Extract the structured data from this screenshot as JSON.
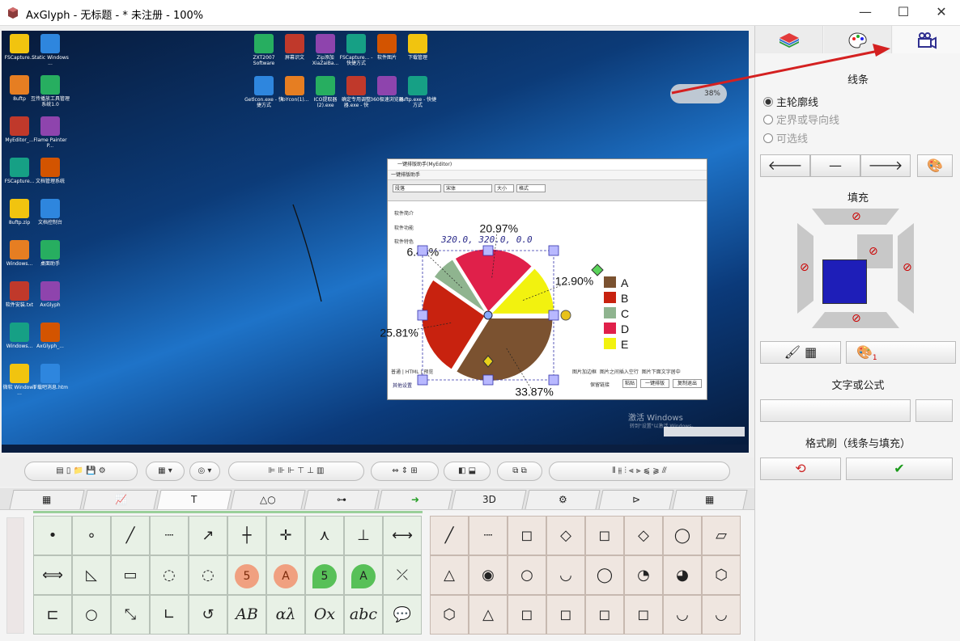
{
  "window": {
    "title": "AxGlyph - 无标题 - * 未注册 - 100%",
    "minimize": "—",
    "maximize": "☐",
    "close": "✕"
  },
  "desktop": {
    "icons": [
      {
        "label": "FSCapture..."
      },
      {
        "label": "Static Windows ..."
      },
      {
        "label": "8uftp"
      },
      {
        "label": "互传播放工具管理系统1.0"
      },
      {
        "label": "MyEditor_..."
      },
      {
        "label": "Flame Painter P..."
      },
      {
        "label": "FSCapture..."
      },
      {
        "label": "文档管理系统"
      },
      {
        "label": "8uftp.zip"
      },
      {
        "label": "文档控制台"
      },
      {
        "label": "Windows..."
      },
      {
        "label": "桌面助手"
      },
      {
        "label": "软件安装.txt"
      },
      {
        "label": "AxGlyph"
      },
      {
        "label": "Windows..."
      },
      {
        "label": "AxGlyph_..."
      },
      {
        "label": "微软 Windows ..."
      },
      {
        "label": "下载吧消息.htm"
      }
    ],
    "top_icons": [
      {
        "label": "ZXT2007 Software"
      },
      {
        "label": "屏幕识文"
      },
      {
        "label": "Zip添加 XiaZaiBa..."
      },
      {
        "label": "FSCapture... - 快捷方式"
      },
      {
        "label": "软件图片"
      },
      {
        "label": "下载管理"
      },
      {
        "label": "Getlcon.exe - 快捷方式"
      },
      {
        "label": "ToYcon(1)..."
      },
      {
        "label": "ICO提取器 (2).exe"
      },
      {
        "label": "确定专用调整器.exe - 快"
      },
      {
        "label": "360极速浏览器"
      },
      {
        "label": "8uftp.exe - 快捷方式"
      }
    ],
    "watermark": "激活 Windows",
    "watermark_sub": "转到\"设置\"以激活 Windows。",
    "speed_widget": "38%"
  },
  "editor": {
    "title": "一键排版助手(MyEditor)",
    "tab": "一键排版助手",
    "font_style": "段落",
    "font_name": "宋体",
    "font_size": "大小",
    "format": "格式",
    "lines": [
      "软件简介",
      "软件功能",
      "软件特色"
    ],
    "bottom_tabs": [
      "普通",
      "HTML",
      "预览"
    ],
    "bottom_right": [
      "图片加边框",
      "图片之间插入空行",
      "图片下面文字居中"
    ],
    "bottom_buttons": [
      "粘贴",
      "一键排版",
      "复制退出"
    ],
    "keep_label": "保留链接",
    "bottom_label": "其他设置"
  },
  "chart_data": {
    "type": "pie",
    "title": "",
    "categories": [
      "A",
      "B",
      "C",
      "D",
      "E"
    ],
    "values": [
      33.87,
      25.81,
      6.45,
      20.97,
      12.9
    ],
    "labels": [
      "33.87%",
      "25.81%",
      "6.45%",
      "20.97%",
      "12.90%"
    ],
    "colors": [
      "#7b5230",
      "#c8220f",
      "#8fb48f",
      "#e0204a",
      "#f2f20f"
    ],
    "legend_placement": "right",
    "annotation": "320.0, 320.0, 0.0"
  },
  "right_panel": {
    "tabs": [
      {
        "name": "layers",
        "icon": "layers-icon"
      },
      {
        "name": "palette",
        "icon": "palette-icon"
      },
      {
        "name": "video",
        "icon": "video-camera-icon"
      }
    ],
    "line_section": "线条",
    "radio_options": [
      {
        "label": "主轮廓线",
        "checked": true
      },
      {
        "label": "定界或导向线",
        "checked": false
      },
      {
        "label": "可选线",
        "checked": false
      }
    ],
    "fill_section": "填充",
    "fill_color": "#1e1eb8",
    "text_section": "文字或公式",
    "brush_section": "格式刷（线条与填充）",
    "palette_badge": "1"
  },
  "toolbar_tabs": {
    "labels": [
      "",
      "",
      "T",
      "",
      "",
      "",
      "3D",
      "",
      "",
      ""
    ]
  },
  "shape_grid": {
    "left_cells": [
      "•",
      "∘",
      "",
      "",
      "",
      "",
      "",
      "",
      "",
      "",
      "",
      "",
      "",
      "",
      "",
      "5",
      "A",
      "5",
      "A",
      "",
      "",
      "",
      "",
      "",
      "",
      "AB",
      "αλ",
      "Ox",
      "abc",
      ""
    ]
  }
}
